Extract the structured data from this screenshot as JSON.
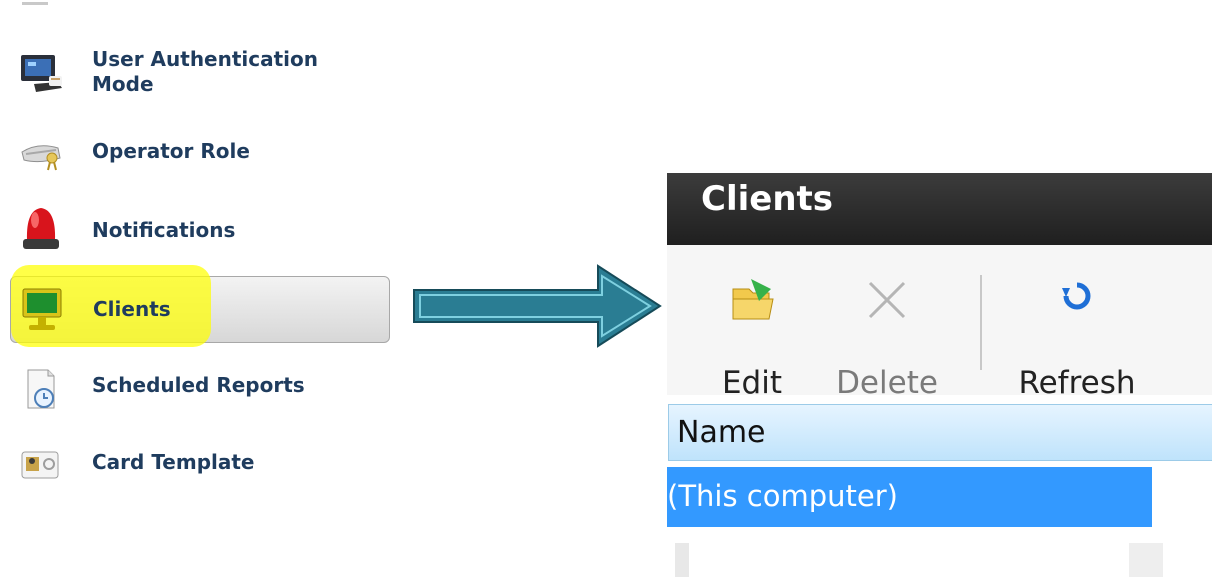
{
  "sidebar": {
    "items": [
      {
        "label": "User Authentication\nMode",
        "icon": "user-authentication-icon"
      },
      {
        "label": "Operator Role",
        "icon": "keyboard-key-icon"
      },
      {
        "label": "Notifications",
        "icon": "alarm-light-icon"
      },
      {
        "label": "Clients",
        "icon": "computer-monitor-icon",
        "selected": true
      },
      {
        "label": "Scheduled Reports",
        "icon": "scheduled-report-icon"
      },
      {
        "label": "Card Template",
        "icon": "card-template-icon"
      }
    ]
  },
  "annotation": {
    "icon": "arrow-right-icon",
    "highlight_color": "#ffff00",
    "arrow_color": "#2a7d93"
  },
  "panel": {
    "title": "Clients",
    "toolbar": {
      "edit": {
        "label": "Edit",
        "icon": "folder-edit-icon"
      },
      "delete": {
        "label": "Delete",
        "icon": "x-icon",
        "disabled": true
      },
      "refresh": {
        "label": "Refresh",
        "icon": "refresh-icon"
      }
    },
    "table": {
      "columns": [
        "Name"
      ],
      "rows": [
        {
          "name": "(This computer)",
          "selected": true
        }
      ]
    },
    "colors": {
      "header_bg": "#2b2b2b",
      "selection": "#3399ff",
      "column_header": "#cde9fb"
    }
  }
}
